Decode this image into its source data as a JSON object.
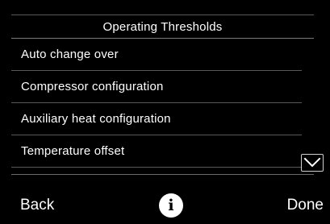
{
  "header": {
    "title": "Operating Thresholds"
  },
  "menu": {
    "items": [
      {
        "label": "Auto change over"
      },
      {
        "label": "Compressor configuration"
      },
      {
        "label": "Auxiliary heat configuration"
      },
      {
        "label": "Temperature offset"
      }
    ]
  },
  "scroll": {
    "down_icon": "chevron-down-icon"
  },
  "footer": {
    "back_label": "Back",
    "info_label": "i",
    "done_label": "Done"
  },
  "colors": {
    "background": "#000000",
    "text": "#ffffff",
    "divider": "#5a5a5a"
  }
}
